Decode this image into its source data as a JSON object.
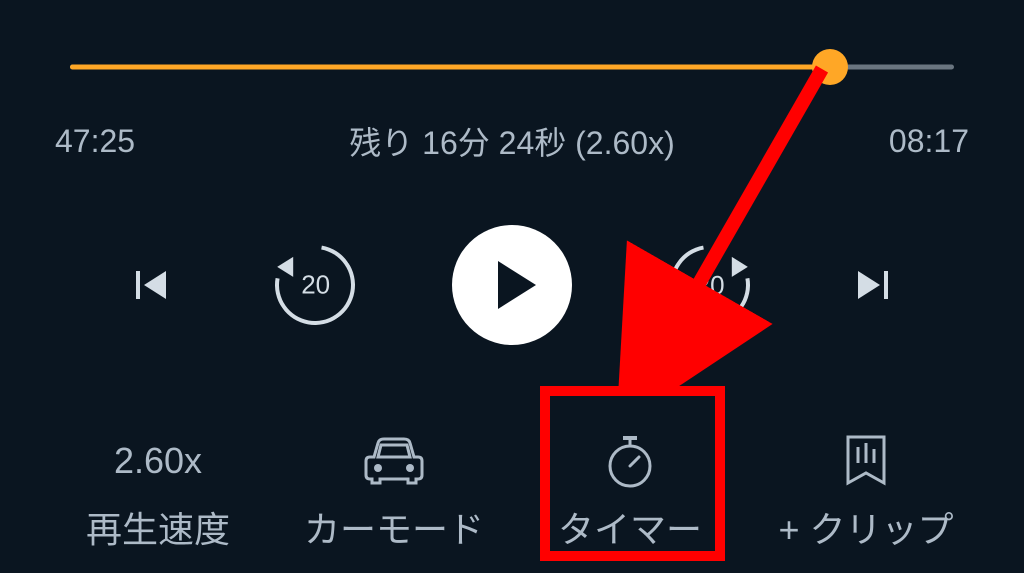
{
  "progress": {
    "percent": 86
  },
  "time": {
    "elapsed": "47:25",
    "remaining_text": "残り 16分 24秒 (2.60x)",
    "total": "08:17"
  },
  "skip": {
    "back_seconds": "20",
    "forward_seconds": "20"
  },
  "bottom": {
    "speed": {
      "value": "2.60x",
      "label": "再生速度"
    },
    "car_mode": {
      "label": "カーモード"
    },
    "timer": {
      "label": "タイマー"
    },
    "clip": {
      "label": "+ クリップ"
    }
  }
}
